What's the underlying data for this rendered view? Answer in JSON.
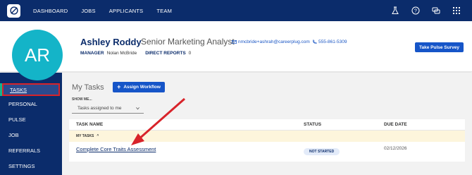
{
  "topnav": {
    "links": [
      "DASHBOARD",
      "JOBS",
      "APPLICANTS",
      "TEAM"
    ],
    "icons": [
      "flask-icon",
      "help-icon",
      "chat-icon",
      "grid-icon"
    ]
  },
  "profile": {
    "initials": "AR",
    "name": "Ashley Roddy",
    "title": "Senior Marketing Analyst",
    "email": "nmcbride+ashrah@careerplug.com",
    "phone": "555-861-5309",
    "manager_label": "MANAGER",
    "manager_value": "Nolan McBride",
    "reports_label": "DIRECT REPORTS",
    "reports_value": "0",
    "pulse_button": "Take Pulse Survey"
  },
  "sidebar": {
    "items": [
      "TASKS",
      "PERSONAL",
      "PULSE",
      "JOB",
      "REFERRALS",
      "SETTINGS"
    ]
  },
  "main": {
    "heading": "My Tasks",
    "assign_button": "Assign Workflow",
    "show_me_label": "SHOW ME...",
    "select_value": "Tasks assigned to me",
    "columns": [
      "TASK NAME",
      "STATUS",
      "DUE DATE"
    ],
    "group_label": "MY TASKS",
    "row": {
      "task": "Complete Core Traits Assessment",
      "status": "NOT STARTED",
      "due": "02/12/2026"
    }
  },
  "colors": {
    "navy": "#0b2c6b",
    "accent_blue": "#1655c8",
    "avatar_teal": "#14b4c8",
    "highlight_red": "#d8232a"
  }
}
